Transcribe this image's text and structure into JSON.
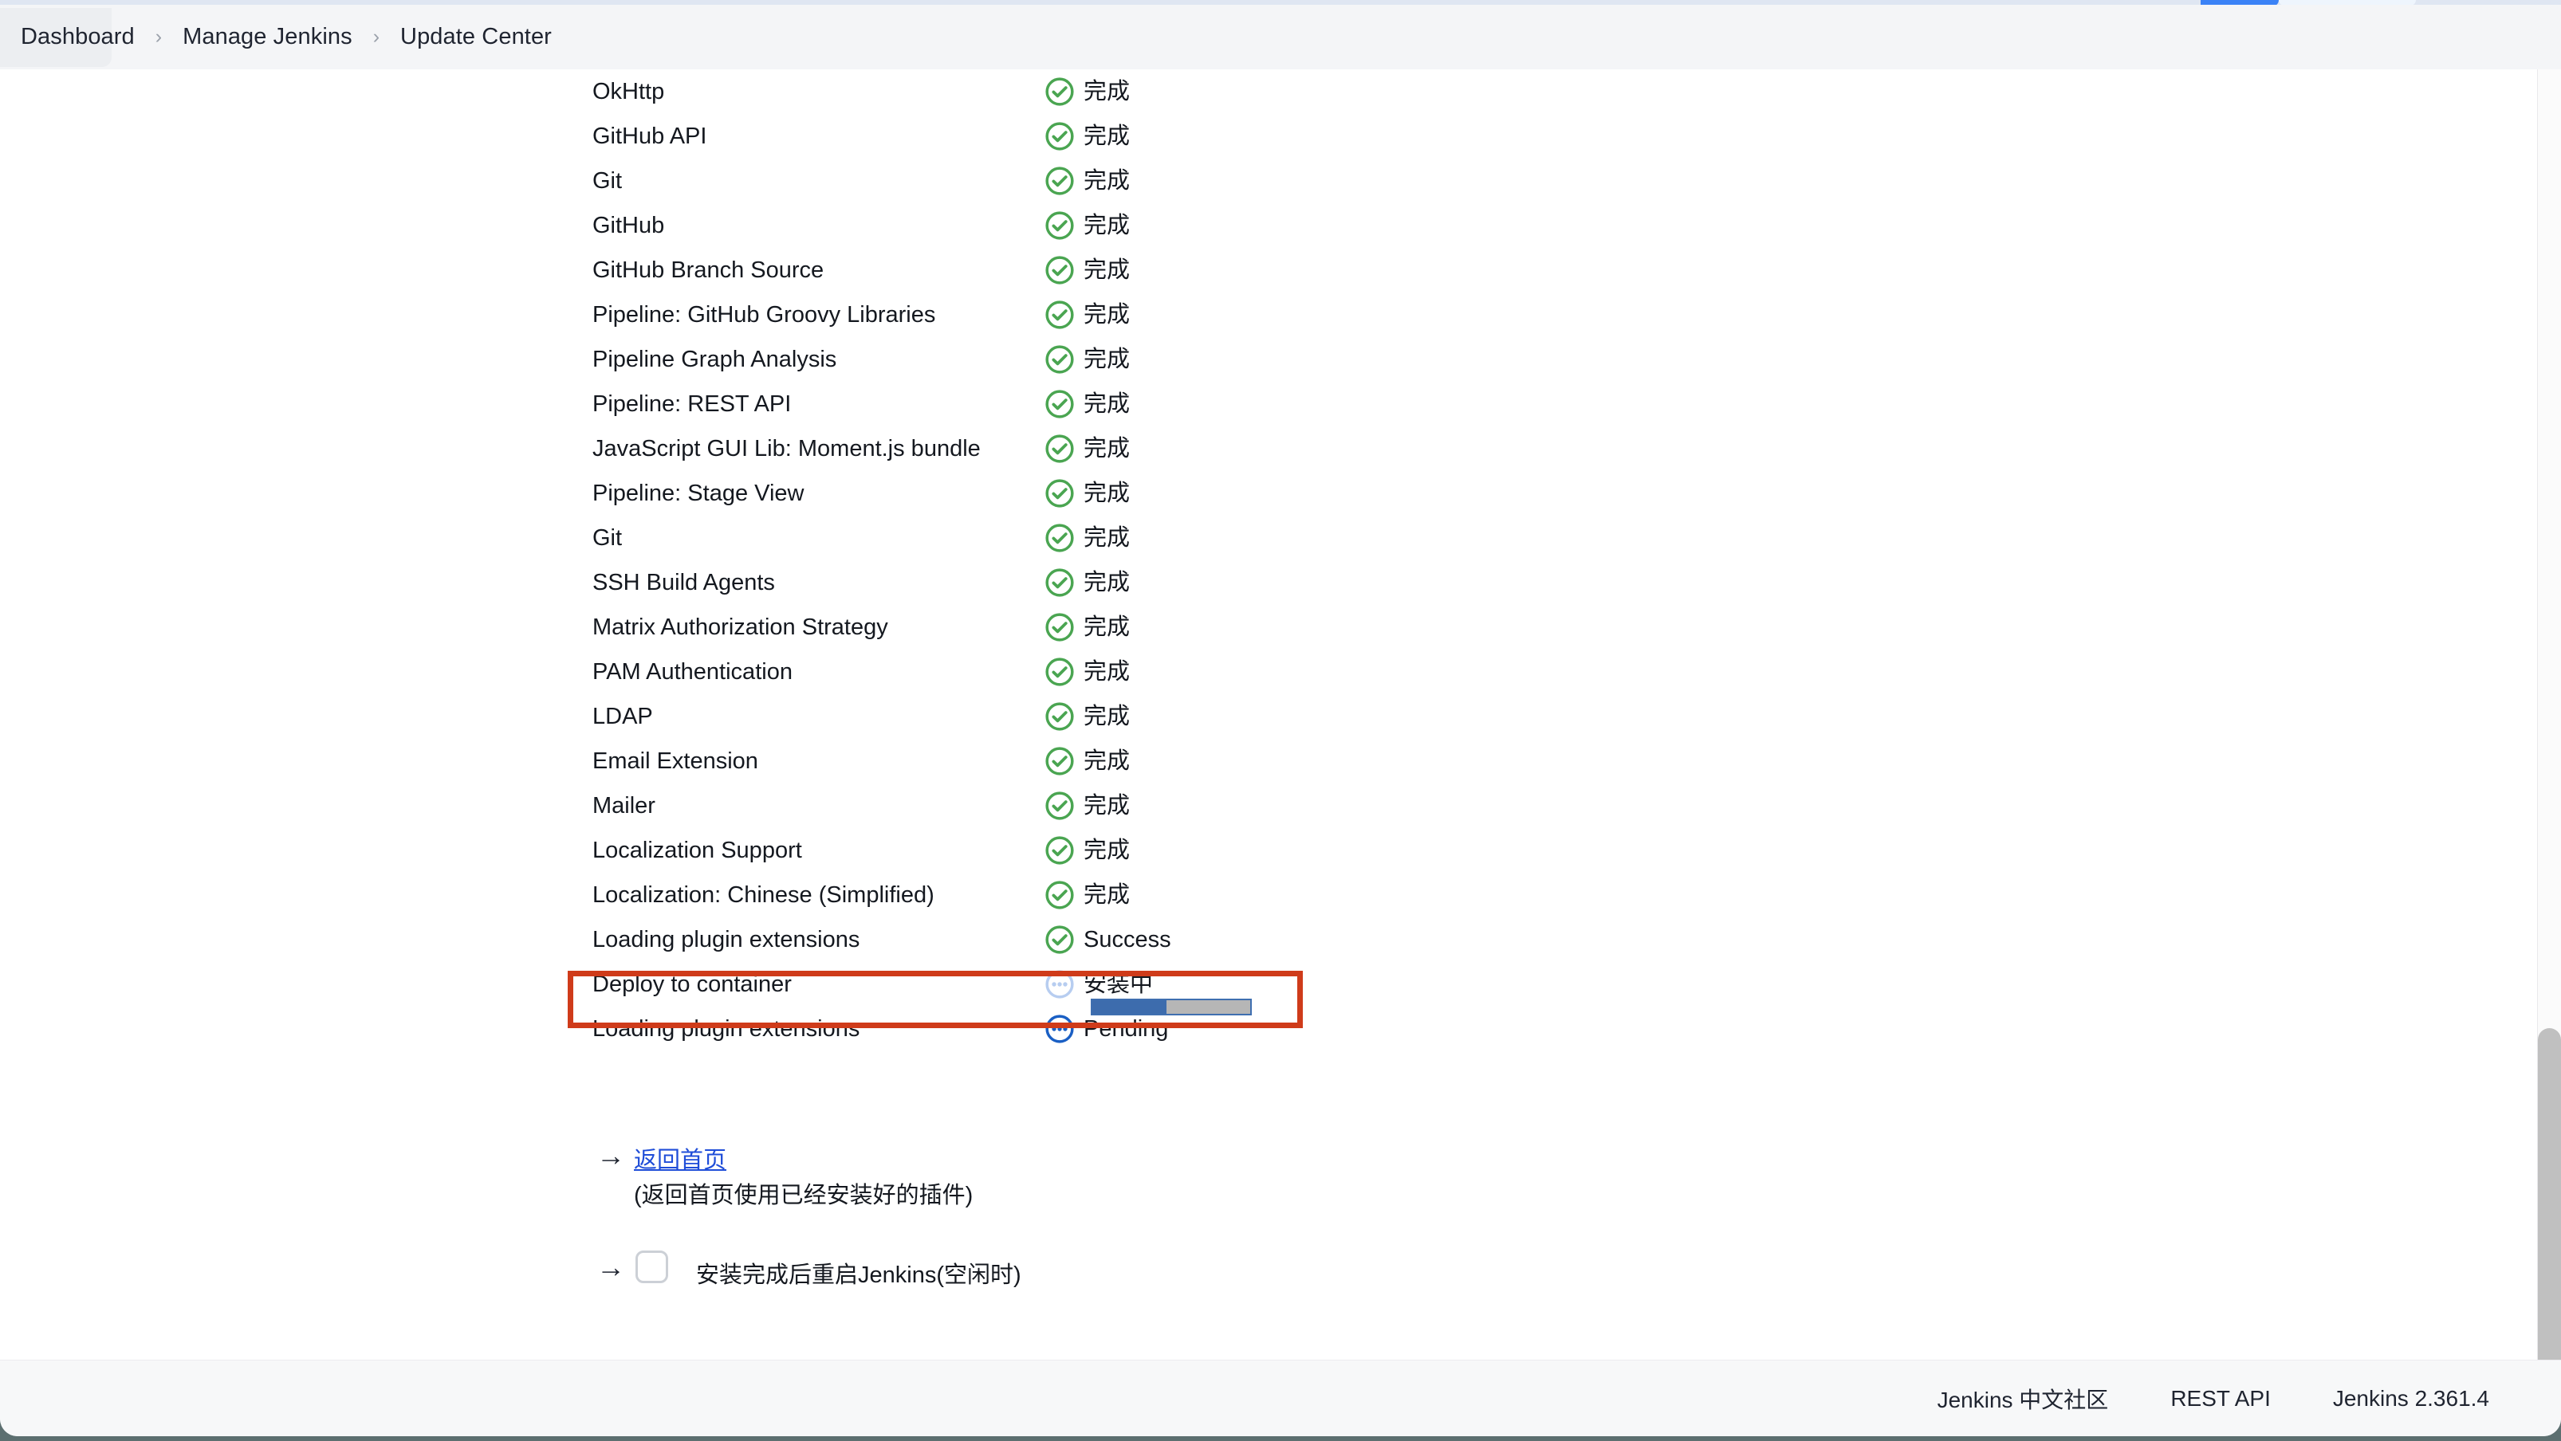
{
  "breadcrumb": {
    "items": [
      "Dashboard",
      "Manage Jenkins",
      "Update Center"
    ],
    "separator": "›"
  },
  "plugin_install": {
    "rows": [
      {
        "name": "OkHttp",
        "status": "完成",
        "state": "success"
      },
      {
        "name": "GitHub API",
        "status": "完成",
        "state": "success"
      },
      {
        "name": "Git",
        "status": "完成",
        "state": "success"
      },
      {
        "name": "GitHub",
        "status": "完成",
        "state": "success"
      },
      {
        "name": "GitHub Branch Source",
        "status": "完成",
        "state": "success"
      },
      {
        "name": "Pipeline: GitHub Groovy Libraries",
        "status": "完成",
        "state": "success"
      },
      {
        "name": "Pipeline Graph Analysis",
        "status": "完成",
        "state": "success"
      },
      {
        "name": "Pipeline: REST API",
        "status": "完成",
        "state": "success"
      },
      {
        "name": "JavaScript GUI Lib: Moment.js bundle",
        "status": "完成",
        "state": "success"
      },
      {
        "name": "Pipeline: Stage View",
        "status": "完成",
        "state": "success"
      },
      {
        "name": "Git",
        "status": "完成",
        "state": "success"
      },
      {
        "name": "SSH Build Agents",
        "status": "完成",
        "state": "success"
      },
      {
        "name": "Matrix Authorization Strategy",
        "status": "完成",
        "state": "success"
      },
      {
        "name": "PAM Authentication",
        "status": "完成",
        "state": "success"
      },
      {
        "name": "LDAP",
        "status": "完成",
        "state": "success"
      },
      {
        "name": "Email Extension",
        "status": "完成",
        "state": "success"
      },
      {
        "name": "Mailer",
        "status": "完成",
        "state": "success"
      },
      {
        "name": "Localization Support",
        "status": "完成",
        "state": "success"
      },
      {
        "name": "Localization: Chinese (Simplified)",
        "status": "完成",
        "state": "success"
      },
      {
        "name": "Loading plugin extensions",
        "status": "Success",
        "state": "success"
      },
      {
        "name": "Deploy to container",
        "status": "安装中",
        "state": "installing",
        "progress_percent": 47
      },
      {
        "name": "Loading plugin extensions",
        "status": "Pending",
        "state": "pending"
      }
    ],
    "highlighted_row_index": 20
  },
  "actions": {
    "arrow": "→",
    "home_link": "返回首页",
    "home_note": "(返回首页使用已经安装好的插件)",
    "restart_label": "安装完成后重启Jenkins(空闲时)",
    "restart_checked": false
  },
  "footer": {
    "items": [
      {
        "label": "Jenkins 中文社区",
        "link": true
      },
      {
        "label": "REST API",
        "link": true
      },
      {
        "label": "Jenkins 2.361.4",
        "link": false
      }
    ]
  },
  "colors": {
    "success_green": "#4aa551",
    "installing_blue_pale": "#b7cdf0",
    "pending_blue": "#1a5fc4",
    "progress_fill": "#3d6cad",
    "progress_track": "#b6b6b6",
    "highlight_red": "#cf3b1a",
    "link_blue": "#1f4dd8"
  }
}
